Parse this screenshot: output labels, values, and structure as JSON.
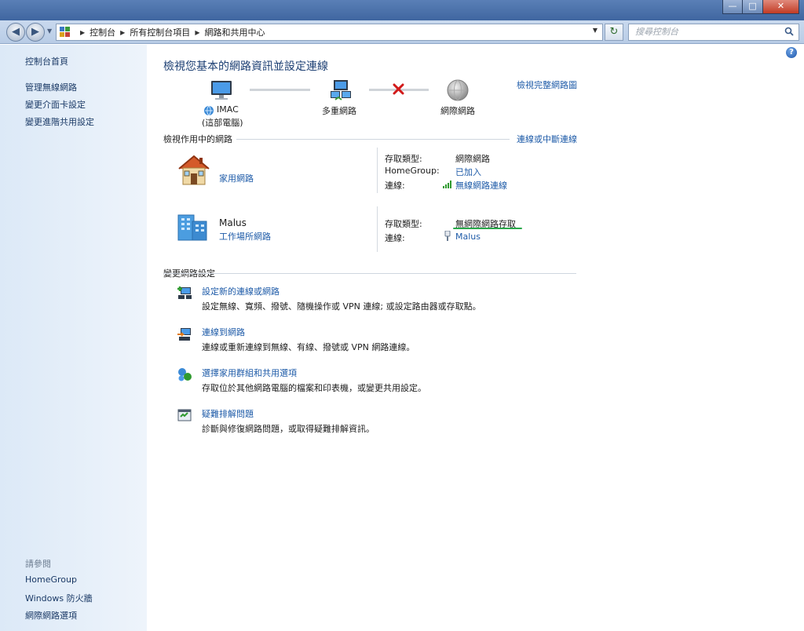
{
  "window": {
    "minimize": "—",
    "maximize": "□",
    "close": "✕"
  },
  "nav": {
    "back": "◀",
    "forward": "▶",
    "breadcrumbs": [
      "控制台",
      "所有控制台項目",
      "網路和共用中心"
    ],
    "search_placeholder": "搜尋控制台"
  },
  "sidebar": {
    "links": [
      "控制台首頁",
      "管理無線網路",
      "變更介面卡設定",
      "變更進階共用設定"
    ],
    "see_also_heading": "請參閱",
    "see_also": [
      "HomeGroup",
      "Windows 防火牆",
      "網際網路選項"
    ]
  },
  "main": {
    "title": "檢視您基本的網路資訊並設定連線",
    "view_full_map": "檢視完整網路圖",
    "map": {
      "computer_name": "IMAC",
      "computer_sub": "(這部電腦)",
      "multiple_networks": "多重網路",
      "internet": "網際網路"
    },
    "active_header": "檢視作用中的網路",
    "connect_disconnect": "連線或中斷連線",
    "networks": [
      {
        "name": "",
        "type_link": "家用網路",
        "access_label": "存取類型:",
        "access_value": "網際網路",
        "homegroup_label": "HomeGroup:",
        "homegroup_value": "已加入",
        "conn_label": "連線:",
        "conn_value": "無線網路連線"
      },
      {
        "name": "Malus",
        "type_link": "工作場所網路",
        "access_label": "存取類型:",
        "access_value": "無網際網路存取",
        "conn_label": "連線:",
        "conn_value": "Malus"
      }
    ],
    "change_header": "變更網路設定",
    "tasks": [
      {
        "link": "設定新的連線或網路",
        "desc": "設定無線、寬頻、撥號、隨機操作或 VPN 連線; 或設定路由器或存取點。"
      },
      {
        "link": "連線到網路",
        "desc": "連線或重新連線到無線、有線、撥號或 VPN 網路連線。"
      },
      {
        "link": "選擇家用群組和共用選項",
        "desc": "存取位於其他網路電腦的檔案和印表機，或變更共用設定。"
      },
      {
        "link": "疑難排解問題",
        "desc": "診斷與修復網路問題，或取得疑難排解資訊。"
      }
    ]
  },
  "colors": {
    "link": "#1e5ba8",
    "title": "#1c3f73",
    "sidebar_bg": "#dce9f7",
    "highlight_underline": "#2aa84a"
  }
}
